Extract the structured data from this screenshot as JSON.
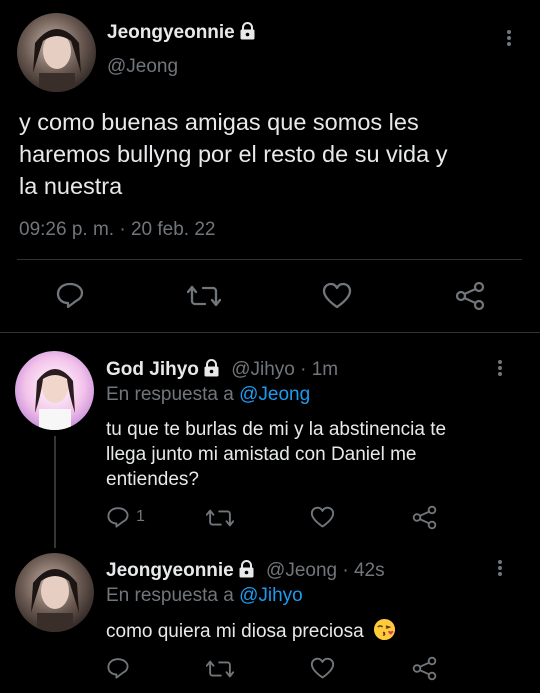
{
  "main_tweet": {
    "display_name": "Jeongyeonnie",
    "handle": "@Jeong",
    "text_lines": [
      "y como buenas amigas que somos les",
      "haremos bullyng por el resto de su vida y",
      "la nuestra"
    ],
    "timestamp": "09:26 p. m. · 20 feb. 22"
  },
  "replies": [
    {
      "display_name": "God Jihyo",
      "handle": "@Jihyo",
      "time": "· 1m",
      "replying_prefix": "En respuesta a",
      "replying_to": "@Jeong",
      "text_lines": [
        "tu que te burlas de mi y la abstinencia te",
        "llega junto mi amistad con Daniel me",
        "entiendes?"
      ],
      "reply_count": "1"
    },
    {
      "display_name": "Jeongyeonnie",
      "handle": "@Jeong",
      "time": "· 42s",
      "replying_prefix": "En respuesta a",
      "replying_to": "@Jihyo",
      "text": "como quiera mi diosa preciosa",
      "emoji": "😘"
    }
  ],
  "icons": [
    "lock-icon",
    "more-icon",
    "reply-icon",
    "retweet-icon",
    "like-icon",
    "share-icon"
  ],
  "colors": {
    "background": "#000000",
    "link": "#1d9bf0",
    "muted": "#71767b",
    "text": "#e7e9ea"
  }
}
